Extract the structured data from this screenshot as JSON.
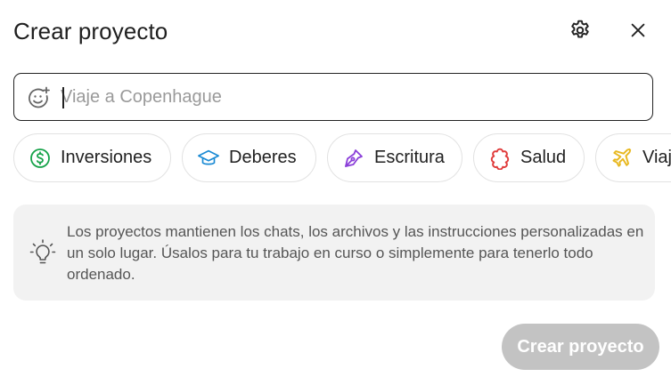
{
  "dialog": {
    "title": "Crear proyecto",
    "settings_icon": "gear-icon",
    "close_icon": "close-icon"
  },
  "input": {
    "value": "",
    "placeholder": "Viaje a Copenhague",
    "emoji_icon": "add-emoji-icon"
  },
  "chips": [
    {
      "label": "Inversiones",
      "icon": "dollar-circle-icon",
      "color": "#17a34a"
    },
    {
      "label": "Deberes",
      "icon": "graduation-cap-icon",
      "color": "#1a8ad4"
    },
    {
      "label": "Escritura",
      "icon": "pen-nib-icon",
      "color": "#8b3fd9"
    },
    {
      "label": "Salud",
      "icon": "health-badge-icon",
      "color": "#e03c3c"
    },
    {
      "label": "Viaj",
      "icon": "airplane-icon",
      "color": "#e8b820"
    }
  ],
  "info": {
    "icon": "lightbulb-icon",
    "text": "Los proyectos mantienen los chats, los archivos y las instrucciones personalizadas en un solo lugar. Úsalos para tu trabajo en curso o simplemente para tenerlo todo ordenado."
  },
  "footer": {
    "create_label": "Crear proyecto",
    "create_enabled": false
  }
}
